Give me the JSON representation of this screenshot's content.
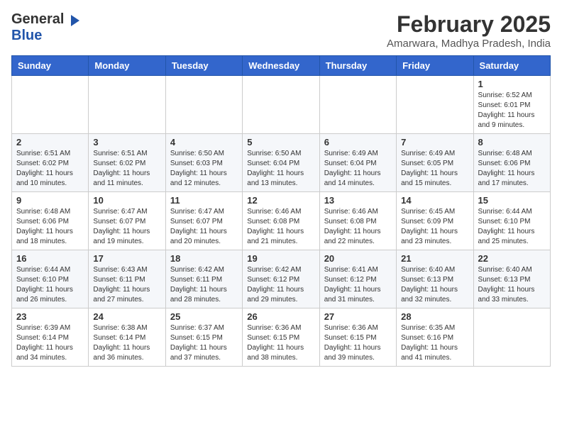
{
  "header": {
    "logo_general": "General",
    "logo_blue": "Blue",
    "month_year": "February 2025",
    "location": "Amarwara, Madhya Pradesh, India"
  },
  "weekdays": [
    "Sunday",
    "Monday",
    "Tuesday",
    "Wednesday",
    "Thursday",
    "Friday",
    "Saturday"
  ],
  "weeks": [
    [
      {
        "day": null
      },
      {
        "day": null
      },
      {
        "day": null
      },
      {
        "day": null
      },
      {
        "day": null
      },
      {
        "day": null
      },
      {
        "day": "1",
        "sunrise": "6:52 AM",
        "sunset": "6:01 PM",
        "daylight": "11 hours and 9 minutes."
      }
    ],
    [
      {
        "day": "2",
        "sunrise": "6:51 AM",
        "sunset": "6:02 PM",
        "daylight": "11 hours and 10 minutes."
      },
      {
        "day": "3",
        "sunrise": "6:51 AM",
        "sunset": "6:02 PM",
        "daylight": "11 hours and 11 minutes."
      },
      {
        "day": "4",
        "sunrise": "6:50 AM",
        "sunset": "6:03 PM",
        "daylight": "11 hours and 12 minutes."
      },
      {
        "day": "5",
        "sunrise": "6:50 AM",
        "sunset": "6:04 PM",
        "daylight": "11 hours and 13 minutes."
      },
      {
        "day": "6",
        "sunrise": "6:49 AM",
        "sunset": "6:04 PM",
        "daylight": "11 hours and 14 minutes."
      },
      {
        "day": "7",
        "sunrise": "6:49 AM",
        "sunset": "6:05 PM",
        "daylight": "11 hours and 15 minutes."
      },
      {
        "day": "8",
        "sunrise": "6:48 AM",
        "sunset": "6:06 PM",
        "daylight": "11 hours and 17 minutes."
      }
    ],
    [
      {
        "day": "9",
        "sunrise": "6:48 AM",
        "sunset": "6:06 PM",
        "daylight": "11 hours and 18 minutes."
      },
      {
        "day": "10",
        "sunrise": "6:47 AM",
        "sunset": "6:07 PM",
        "daylight": "11 hours and 19 minutes."
      },
      {
        "day": "11",
        "sunrise": "6:47 AM",
        "sunset": "6:07 PM",
        "daylight": "11 hours and 20 minutes."
      },
      {
        "day": "12",
        "sunrise": "6:46 AM",
        "sunset": "6:08 PM",
        "daylight": "11 hours and 21 minutes."
      },
      {
        "day": "13",
        "sunrise": "6:46 AM",
        "sunset": "6:08 PM",
        "daylight": "11 hours and 22 minutes."
      },
      {
        "day": "14",
        "sunrise": "6:45 AM",
        "sunset": "6:09 PM",
        "daylight": "11 hours and 23 minutes."
      },
      {
        "day": "15",
        "sunrise": "6:44 AM",
        "sunset": "6:10 PM",
        "daylight": "11 hours and 25 minutes."
      }
    ],
    [
      {
        "day": "16",
        "sunrise": "6:44 AM",
        "sunset": "6:10 PM",
        "daylight": "11 hours and 26 minutes."
      },
      {
        "day": "17",
        "sunrise": "6:43 AM",
        "sunset": "6:11 PM",
        "daylight": "11 hours and 27 minutes."
      },
      {
        "day": "18",
        "sunrise": "6:42 AM",
        "sunset": "6:11 PM",
        "daylight": "11 hours and 28 minutes."
      },
      {
        "day": "19",
        "sunrise": "6:42 AM",
        "sunset": "6:12 PM",
        "daylight": "11 hours and 29 minutes."
      },
      {
        "day": "20",
        "sunrise": "6:41 AM",
        "sunset": "6:12 PM",
        "daylight": "11 hours and 31 minutes."
      },
      {
        "day": "21",
        "sunrise": "6:40 AM",
        "sunset": "6:13 PM",
        "daylight": "11 hours and 32 minutes."
      },
      {
        "day": "22",
        "sunrise": "6:40 AM",
        "sunset": "6:13 PM",
        "daylight": "11 hours and 33 minutes."
      }
    ],
    [
      {
        "day": "23",
        "sunrise": "6:39 AM",
        "sunset": "6:14 PM",
        "daylight": "11 hours and 34 minutes."
      },
      {
        "day": "24",
        "sunrise": "6:38 AM",
        "sunset": "6:14 PM",
        "daylight": "11 hours and 36 minutes."
      },
      {
        "day": "25",
        "sunrise": "6:37 AM",
        "sunset": "6:15 PM",
        "daylight": "11 hours and 37 minutes."
      },
      {
        "day": "26",
        "sunrise": "6:36 AM",
        "sunset": "6:15 PM",
        "daylight": "11 hours and 38 minutes."
      },
      {
        "day": "27",
        "sunrise": "6:36 AM",
        "sunset": "6:15 PM",
        "daylight": "11 hours and 39 minutes."
      },
      {
        "day": "28",
        "sunrise": "6:35 AM",
        "sunset": "6:16 PM",
        "daylight": "11 hours and 41 minutes."
      },
      {
        "day": null
      }
    ]
  ]
}
